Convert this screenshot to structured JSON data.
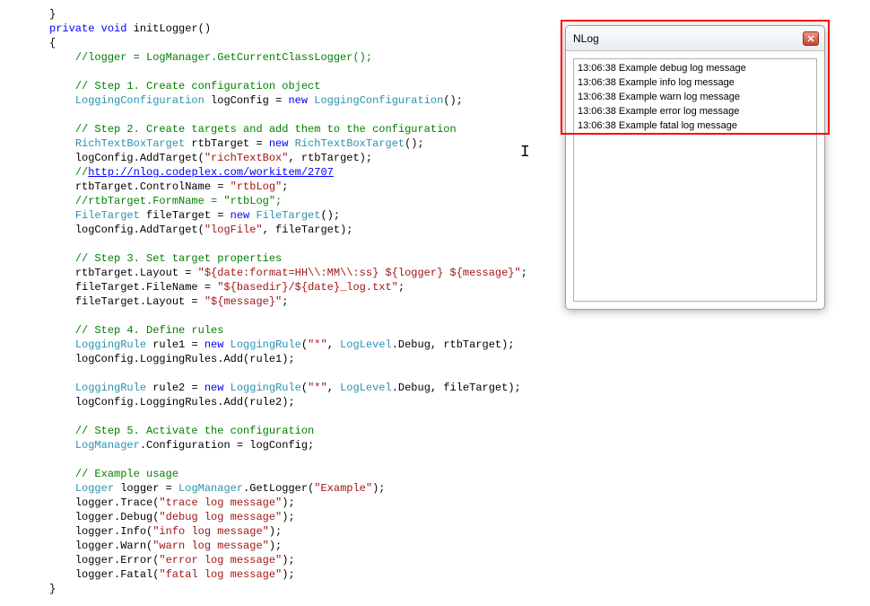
{
  "code": {
    "l0": "}",
    "l1a": "private",
    "l1b": " ",
    "l1c": "void",
    "l1d": " initLogger()",
    "l2": "{",
    "l3": "//logger = LogManager.GetCurrentClassLogger();",
    "l5": "// Step 1. Create configuration object",
    "l6a": "LoggingConfiguration",
    "l6b": " logConfig = ",
    "l6c": "new",
    "l6d": " ",
    "l6e": "LoggingConfiguration",
    "l6f": "();",
    "l8": "// Step 2. Create targets and add them to the configuration",
    "l9a": "RichTextBoxTarget",
    "l9b": " rtbTarget = ",
    "l9c": "new",
    "l9d": " ",
    "l9e": "RichTextBoxTarget",
    "l9f": "();",
    "l10a": "logConfig.AddTarget(",
    "l10b": "\"richTextBox\"",
    "l10c": ", rtbTarget);",
    "l11a": "//",
    "l11b": "http://nlog.codeplex.com/workitem/2707",
    "l12a": "rtbTarget.ControlName = ",
    "l12b": "\"rtbLog\"",
    "l12c": ";",
    "l13": "//rtbTarget.FormName = \"rtbLog\";",
    "l14a": "FileTarget",
    "l14b": " fileTarget = ",
    "l14c": "new",
    "l14d": " ",
    "l14e": "FileTarget",
    "l14f": "();",
    "l15a": "logConfig.AddTarget(",
    "l15b": "\"logFile\"",
    "l15c": ", fileTarget);",
    "l17": "// Step 3. Set target properties",
    "l18a": "rtbTarget.Layout = ",
    "l18b": "\"${date:format=HH\\\\:MM\\\\:ss} ${logger} ${message}\"",
    "l18c": ";",
    "l19a": "fileTarget.FileName = ",
    "l19b": "\"${basedir}/${date}_log.txt\"",
    "l19c": ";",
    "l20a": "fileTarget.Layout = ",
    "l20b": "\"${message}\"",
    "l20c": ";",
    "l22": "// Step 4. Define rules",
    "l23a": "LoggingRule",
    "l23b": " rule1 = ",
    "l23c": "new",
    "l23d": " ",
    "l23e": "LoggingRule",
    "l23f": "(",
    "l23g": "\"*\"",
    "l23h": ", ",
    "l23i": "LogLevel",
    "l23j": ".Debug, rtbTarget);",
    "l24": "logConfig.LoggingRules.Add(rule1);",
    "l26a": "LoggingRule",
    "l26b": " rule2 = ",
    "l26c": "new",
    "l26d": " ",
    "l26e": "LoggingRule",
    "l26f": "(",
    "l26g": "\"*\"",
    "l26h": ", ",
    "l26i": "LogLevel",
    "l26j": ".Debug, fileTarget);",
    "l27": "logConfig.LoggingRules.Add(rule2);",
    "l29": "// Step 5. Activate the configuration",
    "l30a": "LogManager",
    "l30b": ".Configuration = logConfig;",
    "l32": "// Example usage",
    "l33a": "Logger",
    "l33b": " logger = ",
    "l33c": "LogManager",
    "l33d": ".GetLogger(",
    "l33e": "\"Example\"",
    "l33f": ");",
    "l34a": "logger.Trace(",
    "l34b": "\"trace log message\"",
    "l34c": ");",
    "l35a": "logger.Debug(",
    "l35b": "\"debug log message\"",
    "l35c": ");",
    "l36a": "logger.Info(",
    "l36b": "\"info log message\"",
    "l36c": ");",
    "l37a": "logger.Warn(",
    "l37b": "\"warn log message\"",
    "l37c": ");",
    "l38a": "logger.Error(",
    "l38b": "\"error log message\"",
    "l38c": ");",
    "l39a": "logger.Fatal(",
    "l39b": "\"fatal log message\"",
    "l39c": ");",
    "l40": "}"
  },
  "window": {
    "title": "NLog",
    "logs": [
      "13:06:38 Example debug log message",
      "13:06:38 Example info log message",
      "13:06:38 Example warn log message",
      "13:06:38 Example error log message",
      "13:06:38 Example fatal log message"
    ]
  }
}
